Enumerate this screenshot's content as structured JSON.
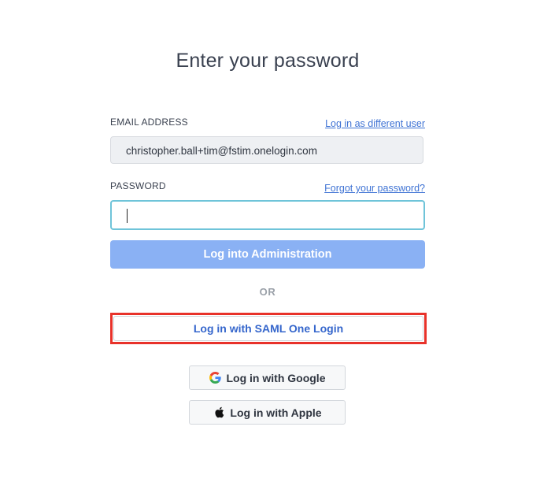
{
  "page": {
    "title": "Enter your password"
  },
  "email": {
    "label": "EMAIL ADDRESS",
    "switch_user_link": "Log in as different user",
    "value": "christopher.ball+tim@fstim.onelogin.com"
  },
  "password": {
    "label": "PASSWORD",
    "forgot_link": "Forgot your password?",
    "value": ""
  },
  "actions": {
    "login_label": "Log into Administration",
    "or_text": "OR",
    "saml_label": "Log in with SAML One Login",
    "google_label": "Log in with Google",
    "apple_label": "Log in with Apple"
  },
  "icons": {
    "google": "google-icon",
    "apple": "apple-icon"
  },
  "colors": {
    "primary_button": "#8ab1f4",
    "link": "#3f73d4",
    "highlight": "#e8322a",
    "input_focus": "#6fc4d9"
  }
}
